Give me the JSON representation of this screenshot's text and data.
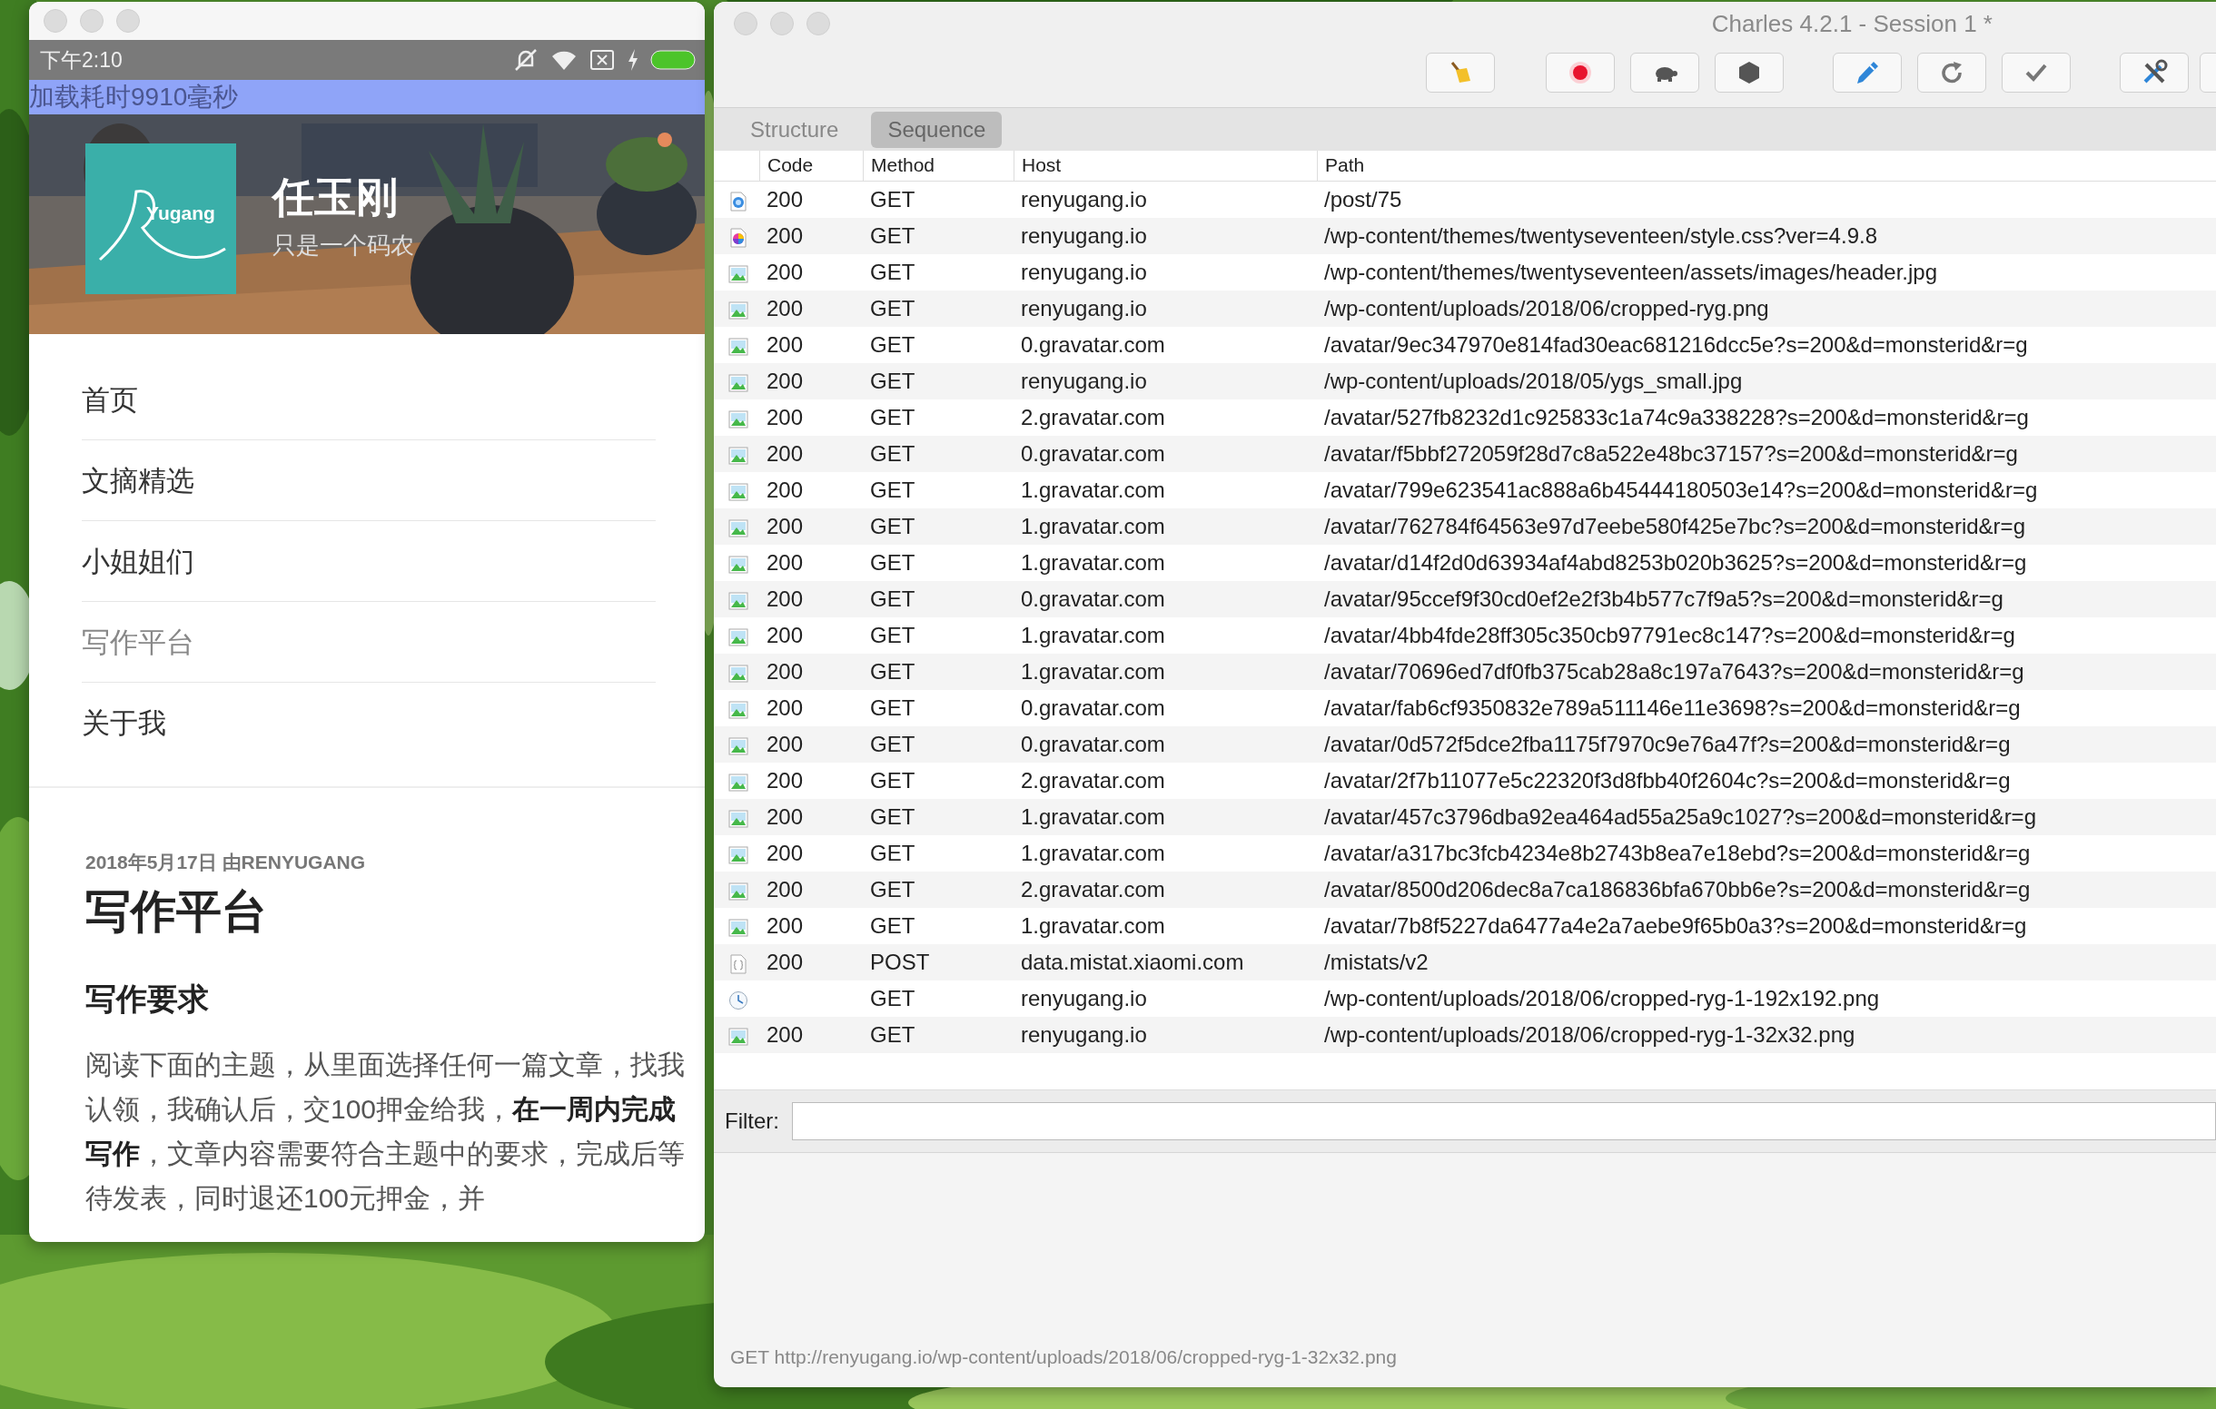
{
  "phone": {
    "status_bar": {
      "time": "下午2:10"
    },
    "banner": "加载耗时9910毫秒",
    "site": {
      "logo_text": "Yugang",
      "title": "任玉刚",
      "tagline": "只是一个码农"
    },
    "menu": [
      {
        "label": "首页",
        "selected": false
      },
      {
        "label": "文摘精选",
        "selected": false
      },
      {
        "label": "小姐姐们",
        "selected": false
      },
      {
        "label": "写作平台",
        "selected": true
      },
      {
        "label": "关于我",
        "selected": false
      }
    ],
    "post": {
      "meta": "2018年5月17日 由RENYUGANG",
      "title": "写作平台",
      "heading": "写作要求",
      "paragraph": "阅读下面的主题，从里面选择任何一篇文章，找我认领，我确认后，交100押金给我，**在一周内完成写作**，文章内容需要符合主题中的要求，完成后等待发表，同时退还100元押金，并"
    }
  },
  "charles": {
    "window": {
      "title": "Charles 4.2.1 - Session 1 *"
    },
    "tabs": [
      {
        "label": "Structure",
        "selected": false
      },
      {
        "label": "Sequence",
        "selected": true
      }
    ],
    "table": {
      "columns": [
        "Code",
        "Method",
        "Host",
        "Path"
      ],
      "rows": [
        {
          "kind": "html",
          "code": "200",
          "method": "GET",
          "host": "renyugang.io",
          "path": "/post/75"
        },
        {
          "kind": "css",
          "code": "200",
          "method": "GET",
          "host": "renyugang.io",
          "path": "/wp-content/themes/twentyseventeen/style.css?ver=4.9.8"
        },
        {
          "code": "200",
          "method": "GET",
          "host": "renyugang.io",
          "path": "/wp-content/themes/twentyseventeen/assets/images/header.jpg"
        },
        {
          "code": "200",
          "method": "GET",
          "host": "renyugang.io",
          "path": "/wp-content/uploads/2018/06/cropped-ryg.png"
        },
        {
          "code": "200",
          "method": "GET",
          "host": "0.gravatar.com",
          "path": "/avatar/9ec347970e814fad30eac681216dcc5e?s=200&d=monsterid&r=g"
        },
        {
          "code": "200",
          "method": "GET",
          "host": "renyugang.io",
          "path": "/wp-content/uploads/2018/05/ygs_small.jpg"
        },
        {
          "code": "200",
          "method": "GET",
          "host": "2.gravatar.com",
          "path": "/avatar/527fb8232d1c925833c1a74c9a338228?s=200&d=monsterid&r=g"
        },
        {
          "code": "200",
          "method": "GET",
          "host": "0.gravatar.com",
          "path": "/avatar/f5bbf272059f28d7c8a522e48bc37157?s=200&d=monsterid&r=g"
        },
        {
          "code": "200",
          "method": "GET",
          "host": "1.gravatar.com",
          "path": "/avatar/799e623541ac888a6b45444180503e14?s=200&d=monsterid&r=g"
        },
        {
          "code": "200",
          "method": "GET",
          "host": "1.gravatar.com",
          "path": "/avatar/762784f64563e97d7eebe580f425e7bc?s=200&d=monsterid&r=g"
        },
        {
          "code": "200",
          "method": "GET",
          "host": "1.gravatar.com",
          "path": "/avatar/d14f2d0d63934af4abd8253b020b3625?s=200&d=monsterid&r=g"
        },
        {
          "code": "200",
          "method": "GET",
          "host": "0.gravatar.com",
          "path": "/avatar/95ccef9f30cd0ef2e2f3b4b577c7f9a5?s=200&d=monsterid&r=g"
        },
        {
          "code": "200",
          "method": "GET",
          "host": "1.gravatar.com",
          "path": "/avatar/4bb4fde28ff305c350cb97791ec8c147?s=200&d=monsterid&r=g"
        },
        {
          "code": "200",
          "method": "GET",
          "host": "1.gravatar.com",
          "path": "/avatar/70696ed7df0fb375cab28a8c197a7643?s=200&d=monsterid&r=g"
        },
        {
          "code": "200",
          "method": "GET",
          "host": "0.gravatar.com",
          "path": "/avatar/fab6cf9350832e789a511146e11e3698?s=200&d=monsterid&r=g"
        },
        {
          "code": "200",
          "method": "GET",
          "host": "0.gravatar.com",
          "path": "/avatar/0d572f5dce2fba1175f7970c9e76a47f?s=200&d=monsterid&r=g"
        },
        {
          "code": "200",
          "method": "GET",
          "host": "2.gravatar.com",
          "path": "/avatar/2f7b11077e5c22320f3d8fbb40f2604c?s=200&d=monsterid&r=g"
        },
        {
          "code": "200",
          "method": "GET",
          "host": "1.gravatar.com",
          "path": "/avatar/457c3796dba92ea464ad55a25a9c1027?s=200&d=monsterid&r=g"
        },
        {
          "code": "200",
          "method": "GET",
          "host": "1.gravatar.com",
          "path": "/avatar/a317bc3fcb4234e8b2743b8ea7e18ebd?s=200&d=monsterid&r=g"
        },
        {
          "code": "200",
          "method": "GET",
          "host": "2.gravatar.com",
          "path": "/avatar/8500d206dec8a7ca186836bfa670bb6e?s=200&d=monsterid&r=g"
        },
        {
          "code": "200",
          "method": "GET",
          "host": "1.gravatar.com",
          "path": "/avatar/7b8f5227da6477a4e2a7aebe9f65b0a3?s=200&d=monsterid&r=g"
        },
        {
          "kind": "json",
          "code": "200",
          "method": "POST",
          "host": "data.mistat.xiaomi.com",
          "path": "/mistats/v2"
        },
        {
          "kind": "pending",
          "method": "GET",
          "host": "renyugang.io",
          "path": "/wp-content/uploads/2018/06/cropped-ryg-1-192x192.png"
        },
        {
          "code": "200",
          "method": "GET",
          "host": "renyugang.io",
          "path": "/wp-content/uploads/2018/06/cropped-ryg-1-32x32.png"
        }
      ]
    },
    "filter": {
      "label": "Filter:"
    },
    "status_bar": "GET http://renyugang.io/wp-content/uploads/2018/06/cropped-ryg-1-32x32.png"
  }
}
